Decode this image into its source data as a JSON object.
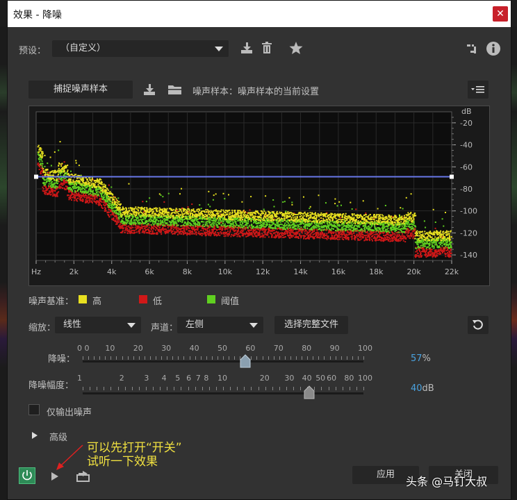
{
  "window": {
    "title": "效果 - 降噪",
    "close_glyph": "✕"
  },
  "preset": {
    "label": "预设：",
    "value": "（自定义）"
  },
  "capture": {
    "button_label": "捕捉噪声样本",
    "sample_label": "噪声样本：噪声样本的当前设置"
  },
  "graph": {
    "db_unit": "dB",
    "y_ticks": [
      "-20",
      "-40",
      "-60",
      "-80",
      "-100",
      "-120",
      "-140"
    ],
    "x_ticks": [
      "Hz",
      "2k",
      "4k",
      "6k",
      "8k",
      "10k",
      "12k",
      "14k",
      "16k",
      "18k",
      "20k",
      "22k"
    ],
    "threshold_db": -69,
    "colors": {
      "high": "#e8e020",
      "low": "#d01818",
      "threshold": "#60d020",
      "line": "#6878e8"
    }
  },
  "legend": {
    "title": "噪声基准：",
    "high": "高",
    "low": "低",
    "threshold": "阈值"
  },
  "scale": {
    "label": "缩放：",
    "value": "线性"
  },
  "channel": {
    "label": "声道：",
    "value": "左侧"
  },
  "select_file": "选择完整文件",
  "noise_reduction": {
    "label": "降噪：",
    "ticks": [
      "0 0",
      "10",
      "20",
      "30",
      "40",
      "50",
      "60",
      "70",
      "80",
      "90",
      "100"
    ],
    "value": "57",
    "unit": "%"
  },
  "reduce_by": {
    "label": "降噪幅度：",
    "ticks": [
      "1",
      "2",
      "3",
      "4",
      "5",
      "6",
      "7",
      "8",
      "10",
      "20",
      "30",
      "40",
      "50",
      "60",
      "80",
      "100"
    ],
    "value": "40",
    "unit": "dB"
  },
  "output_noise_only": "仅输出噪声",
  "advanced": "高级",
  "annotation": {
    "line1": "可以先打开“开关”",
    "line2": "试听一下效果"
  },
  "apply": "应用",
  "close_label": "关闭",
  "watermark": "头条 @马钉大叔"
}
